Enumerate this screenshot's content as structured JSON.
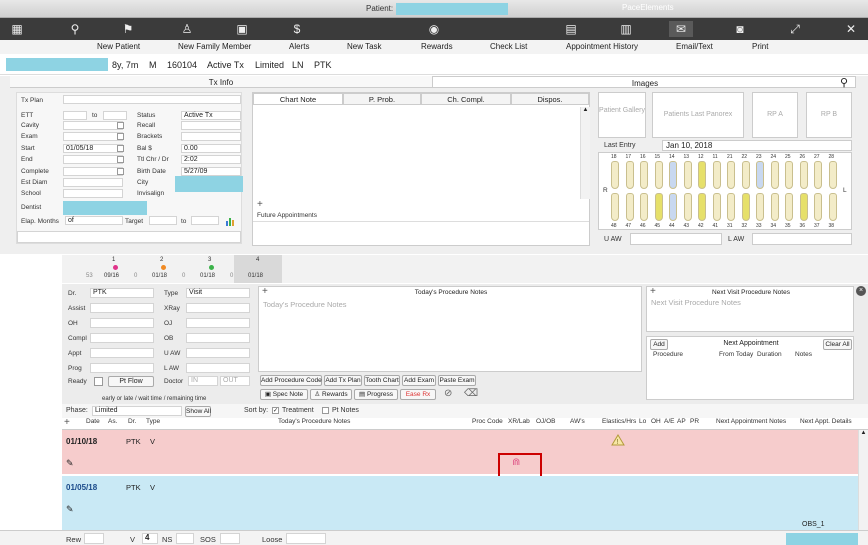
{
  "window": {
    "title_prefix": "Patient:",
    "title_right": "PaceElements"
  },
  "toolbar": [
    {
      "label": "New Patient",
      "icon": "new-patient-icon"
    },
    {
      "label": "New Family Member",
      "icon": "family-member-icon"
    },
    {
      "label": "Alerts",
      "icon": "alert-icon"
    },
    {
      "label": "New Task",
      "icon": "task-icon"
    },
    {
      "label": "Rewards",
      "icon": "rewards-icon"
    },
    {
      "label": "Check List",
      "icon": "checklist-icon"
    },
    {
      "label": "Appointment History",
      "icon": "calendar-icon"
    },
    {
      "label": "Email/Text",
      "icon": "email-icon"
    },
    {
      "label": "Print",
      "icon": "print-icon"
    }
  ],
  "patient": {
    "age": "8y, 7m",
    "sex": "M",
    "id": "160104",
    "status": "Active Tx",
    "plan": "Limited",
    "ln": "LN",
    "dr": "PTK"
  },
  "txinfo": {
    "title": "Tx Info",
    "tx_plan_label": "Tx Plan",
    "etc_label": "ETT",
    "to_label": "to",
    "cavity_label": "Cavity",
    "exam_label": "Exam",
    "start_label": "Start",
    "start_value": "01/05/18",
    "end_label": "End",
    "complete_label": "Complete",
    "est_diam_label": "Est Diam",
    "school_label": "School",
    "status_label": "Status",
    "status_value": "Active Tx",
    "recall_label": "Recall",
    "brackets_label": "Brackets",
    "bal_label": "Bal $",
    "bal_value": "0.00",
    "ttl_label": "Ttl Chr / Dr",
    "ttl_value": "2:02",
    "birth_label": "Birth Date",
    "birth_value": "5/27/09",
    "city_label": "City",
    "invisalign_label": "Invisalign",
    "dentist_label": "Dentist",
    "elap_label": "Elap. Months",
    "elap_value": "of",
    "target_label": "Target",
    "target_to": "to"
  },
  "notes_tabs": [
    "Chart Note",
    "P. Prob.",
    "Ch. Compl.",
    "Dispos."
  ],
  "future_label": "Future Appointments",
  "images": {
    "title": "Images",
    "tiles": [
      "Patient Gallery",
      "Patients Last Panorex",
      "RP A",
      "RP B"
    ],
    "last_entry_label": "Last Entry",
    "last_entry_value": "Jan 10, 2018",
    "upper_nums": [
      "18",
      "17",
      "16",
      "15",
      "14",
      "13",
      "12",
      "11",
      "21",
      "22",
      "23",
      "24",
      "25",
      "26",
      "27",
      "28"
    ],
    "lower_nums": [
      "48",
      "47",
      "46",
      "45",
      "44",
      "43",
      "42",
      "41",
      "31",
      "32",
      "33",
      "34",
      "35",
      "36",
      "37",
      "38"
    ],
    "u_aw": "U AW",
    "l_aw": "L AW",
    "r": "R",
    "l": "L"
  },
  "visits": [
    {
      "num": "1",
      "date": "09/16",
      "gap": "53",
      "color": "#e0338a"
    },
    {
      "num": "2",
      "date": "01/18",
      "gap": "0",
      "color": "#f08a24"
    },
    {
      "num": "3",
      "date": "01/18",
      "gap": "0",
      "color": "#3bb34a"
    },
    {
      "num": "4",
      "date": "01/18",
      "gap": "0",
      "color": ""
    }
  ],
  "proc": {
    "dr_label": "Dr.",
    "dr_value": "PTK",
    "type_label": "Type",
    "type_value": "Visit",
    "assist_label": "Assist",
    "xray_label": "XRay",
    "oh_label": "OH",
    "oj_label": "OJ",
    "compl_label": "Compl",
    "ob_label": "OB",
    "appt_label": "Appt",
    "uaw_label": "U AW",
    "prog_label": "Prog",
    "law_label": "L AW",
    "ready_label": "Ready",
    "ptflow_label": "Pt Flow",
    "doctor_label": "Doctor",
    "in_label": "IN",
    "out_label": "OUT",
    "wait_label": "early or late / wait time / remaining time",
    "today_title": "Today's Procedure Notes",
    "today_placeholder": "Today's Procedure Notes",
    "next_title": "Next Visit Procedure Notes",
    "next_placeholder": "Next Visit Procedure Notes",
    "buttons1": [
      "Add Procedure Code",
      "Add Tx Plan",
      "Tooth Chart",
      "Add Exam",
      "Paste Exam"
    ],
    "buttons2": [
      "Spec Note",
      "Rewards",
      "Progress",
      "Ease Rx"
    ]
  },
  "next_appt": {
    "add": "Add",
    "title": "Next Appointment",
    "clear": "Clear All",
    "cols": [
      "Procedure",
      "From Today",
      "Duration",
      "Notes"
    ]
  },
  "phase": {
    "label": "Phase:",
    "value": "Limited",
    "show_all": "Show All",
    "sort_label": "Sort by:",
    "treatment": "Treatment",
    "pt_notes": "Pt Notes"
  },
  "table": {
    "cols": [
      "Date",
      "As.",
      "Dr.",
      "Type",
      "Today's Procedure Notes",
      "Proc Code",
      "XR/Lab",
      "OJ/OB",
      "AW's",
      "Elastics/Hrs",
      "Lo",
      "OH",
      "A/E",
      "AP",
      "PR",
      "Next Appointment Notes",
      "Next Appt. Details"
    ],
    "rows": [
      {
        "date": "01/10/18",
        "dr": "PTK",
        "type": "V"
      },
      {
        "date": "01/05/18",
        "dr": "PTK",
        "type": "V"
      }
    ],
    "partial": "OBS_1"
  },
  "footer": {
    "rew": "Rew",
    "v": "V",
    "v_value": "4",
    "ns": "NS",
    "sos": "SOS",
    "loose": "Loose"
  }
}
